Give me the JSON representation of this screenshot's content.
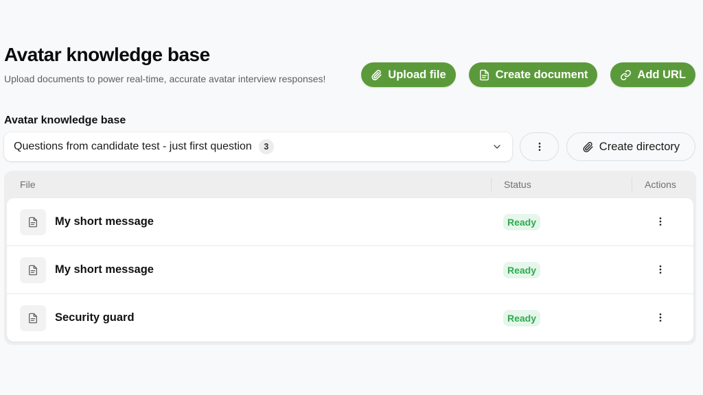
{
  "header": {
    "title": "Avatar knowledge base",
    "subtitle": "Upload documents to power real-time, accurate avatar interview responses!",
    "actions": {
      "upload_file": "Upload file",
      "create_document": "Create document",
      "add_url": "Add URL"
    }
  },
  "directory": {
    "label": "Avatar knowledge base",
    "selected": "Questions from candidate test - just first question",
    "count": "3",
    "create_directory": "Create directory"
  },
  "table": {
    "columns": {
      "file": "File",
      "status": "Status",
      "actions": "Actions"
    },
    "rows": [
      {
        "name": "My short message",
        "status": "Ready"
      },
      {
        "name": "My short message",
        "status": "Ready"
      },
      {
        "name": "Security guard",
        "status": "Ready"
      }
    ]
  },
  "colors": {
    "accent": "#5b9a3a",
    "status_ready_text": "#2faa52",
    "status_ready_bg": "#e6f6ea",
    "background": "#f8f9fa"
  },
  "icons": {
    "upload_file": "paperclip-icon",
    "create_document": "document-icon",
    "add_url": "link-icon",
    "directory_dropdown": "chevron-down-icon",
    "directory_more": "more-vertical-icon",
    "create_directory": "paperclip-icon",
    "file_row": "document-icon",
    "row_actions": "more-vertical-icon"
  }
}
